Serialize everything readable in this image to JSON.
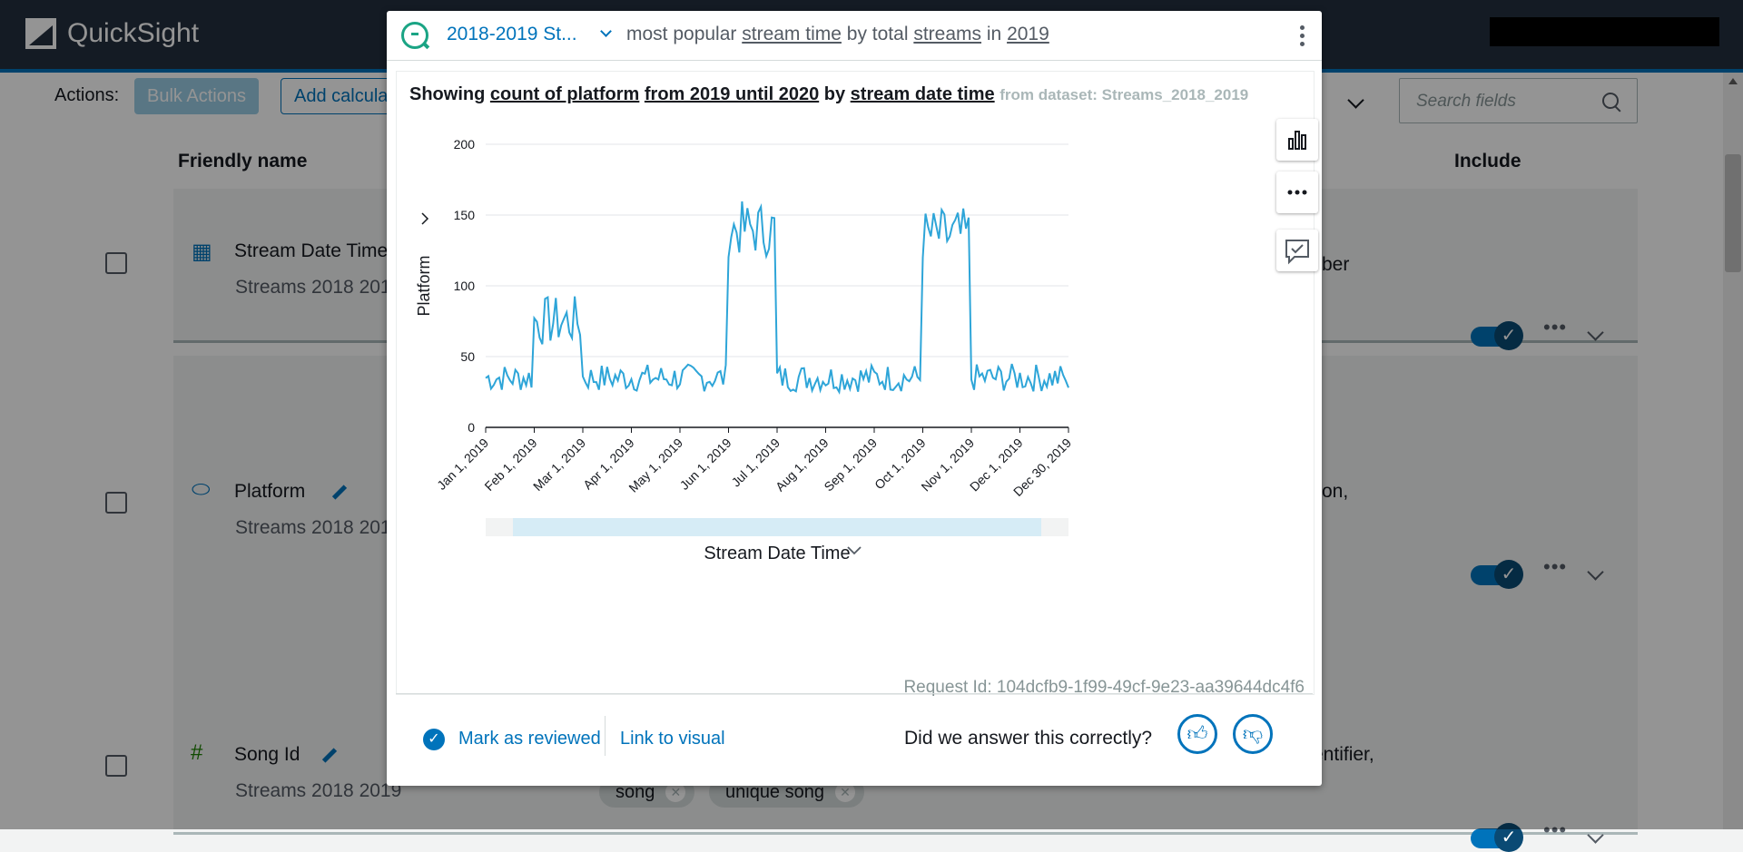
{
  "app": {
    "name": "QuickSight"
  },
  "toolbar": {
    "actions_label": "Actions:",
    "bulk_actions": "Bulk Actions",
    "add_calc": "Add calcula",
    "search_placeholder": "Search fields"
  },
  "columns": {
    "friendly_name": "Friendly name",
    "include": "Include"
  },
  "rows": [
    {
      "icon": "calendar-icon",
      "name": "Stream Date Time",
      "dataset": "Streams 2018 201",
      "desc_fragment": "ber",
      "included": true
    },
    {
      "icon": "dimension-tag-icon",
      "name": "Platform",
      "dataset": "Streams 2018 201",
      "desc_fragment": "on,",
      "included": true
    },
    {
      "icon": "hash-icon",
      "name": "Song Id",
      "dataset": "Streams 2018 2019",
      "desc_fragment": "entifier,",
      "included": true,
      "synonyms": [
        "song",
        "unique song"
      ]
    }
  ],
  "modal": {
    "topic": "2018-2019 St...",
    "query": {
      "prefix": "most popular",
      "metric": "stream time",
      "by": "by total",
      "measure": "streams",
      "in": "in",
      "year": "2019"
    },
    "showing": {
      "lead": "Showing",
      "agg": "count of platform",
      "range": "from 2019 until 2020",
      "by": "by",
      "dim": "stream date time",
      "dataset": "from dataset: Streams_2018_2019"
    },
    "request_id": "Request Id: 104dcfb9-1f99-49cf-9e23-aa39644dc4f6",
    "mark_reviewed": "Mark as reviewed",
    "link_visual": "Link to visual",
    "feedback_question": "Did we answer this correctly?"
  },
  "chart_data": {
    "type": "line",
    "xlabel": "Stream Date Time",
    "ylabel": "Platform",
    "ylim": [
      0,
      200
    ],
    "y_ticks": [
      0,
      50,
      100,
      150,
      200
    ],
    "x_tick_labels": [
      "Jan 1, 2019",
      "Feb 1, 2019",
      "Mar 1, 2019",
      "Apr 1, 2019",
      "May 1, 2019",
      "Jun 1, 2019",
      "Jul 1, 2019",
      "Aug 1, 2019",
      "Sep 1, 2019",
      "Oct 1, 2019",
      "Nov 1, 2019",
      "Dec 1, 2019",
      "Dec 30, 2019"
    ],
    "series_color": "#2ea5d8",
    "approx_levels": [
      {
        "period": "Jan 1, 2019 - Jan 31, 2019",
        "approx_value": 35
      },
      {
        "period": "Feb 1, 2019 - Feb 26, 2019",
        "approx_value": 75
      },
      {
        "period": "Feb 27, 2019 - May 31, 2019",
        "approx_value": 35
      },
      {
        "period": "Jun 1, 2019 - Jun 30, 2019",
        "approx_value": 140
      },
      {
        "period": "Jul 1, 2019 - Sep 30, 2019",
        "approx_value": 35
      },
      {
        "period": "Oct 1, 2019 - Oct 31, 2019",
        "approx_value": 135
      },
      {
        "period": "Nov 1, 2019 - Dec 30, 2019",
        "approx_value": 35
      }
    ]
  },
  "colors": {
    "accent": "#0073bb",
    "topbar": "#232f3e",
    "q_icon": "#1aa484"
  }
}
